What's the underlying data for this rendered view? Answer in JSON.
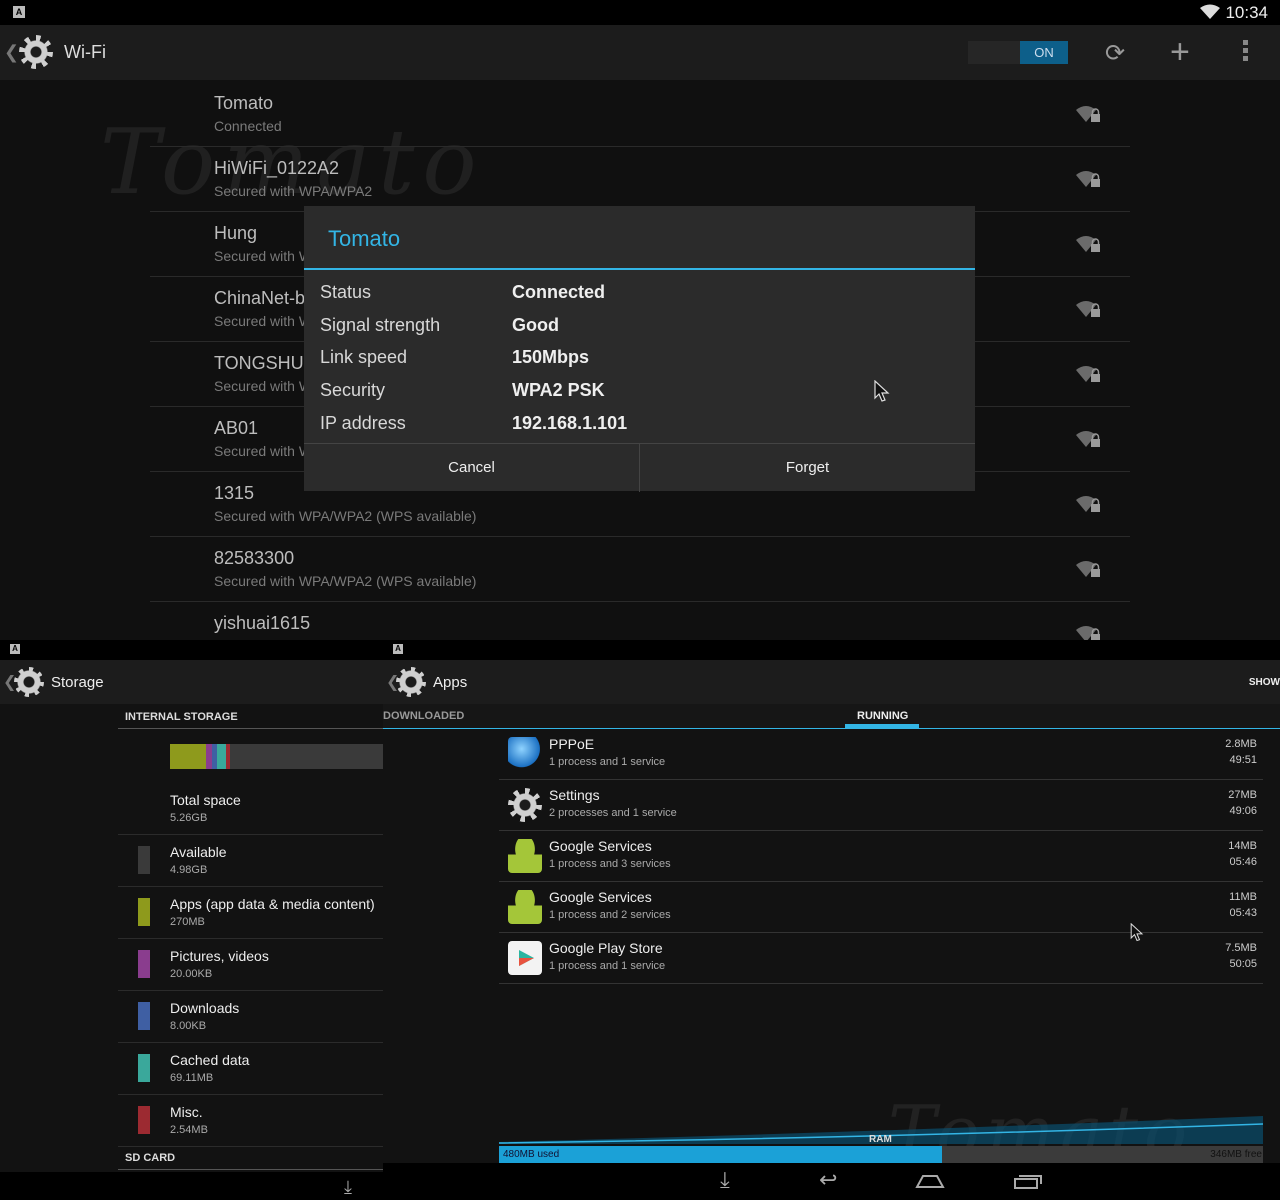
{
  "status_bar": {
    "time": "10:34",
    "notification_glyph": "A"
  },
  "wifi": {
    "back_glyph": "❮",
    "title": "Wi-Fi",
    "toggle_label": "ON",
    "networks": [
      {
        "name": "Tomato",
        "status": "Connected"
      },
      {
        "name": "HiWiFi_0122A2",
        "status": "Secured with WPA/WPA2"
      },
      {
        "name": "Hung",
        "status": "Secured with W"
      },
      {
        "name": "ChinaNet-b",
        "status": "Secured with W"
      },
      {
        "name": "TONGSHUN",
        "status": "Secured with W"
      },
      {
        "name": "AB01",
        "status": "Secured with W"
      },
      {
        "name": "1315",
        "status": "Secured with WPA/WPA2 (WPS available)"
      },
      {
        "name": "82583300",
        "status": "Secured with WPA/WPA2 (WPS available)"
      },
      {
        "name": "yishuai1615",
        "status": ""
      }
    ],
    "watermark": "Tomato"
  },
  "dialog": {
    "title": "Tomato",
    "rows": [
      {
        "label": "Status",
        "value": "Connected"
      },
      {
        "label": "Signal strength",
        "value": "Good"
      },
      {
        "label": "Link speed",
        "value": "150Mbps"
      },
      {
        "label": "Security",
        "value": "WPA2 PSK"
      },
      {
        "label": "IP address",
        "value": "192.168.1.101"
      }
    ],
    "cancel_label": "Cancel",
    "forget_label": "Forget"
  },
  "storage": {
    "notification_glyph": "A",
    "back_glyph": "❮",
    "title": "Storage",
    "internal_header": "INTERNAL STORAGE",
    "sd_header": "SD CARD",
    "total_label": "Total space",
    "total_value": "5.26GB",
    "items": [
      {
        "label": "Available",
        "value": "4.98GB",
        "color": "#3a3a3a"
      },
      {
        "label": "Apps (app data & media content)",
        "value": "270MB",
        "color": "#8e9a1c"
      },
      {
        "label": "Pictures, videos",
        "value": "20.00KB",
        "color": "#8a3d8e"
      },
      {
        "label": "Downloads",
        "value": "8.00KB",
        "color": "#3f5fa3"
      },
      {
        "label": "Cached data",
        "value": "69.11MB",
        "color": "#3aa89b"
      },
      {
        "label": "Misc.",
        "value": "2.54MB",
        "color": "#9c2a31"
      }
    ]
  },
  "apps": {
    "notification_glyph": "A",
    "back_glyph": "❮",
    "title": "Apps",
    "show_label": "SHOW",
    "tabs": {
      "downloaded": "DOWNLOADED",
      "running": "RUNNING"
    },
    "running": [
      {
        "name": "PPPoE",
        "detail": "1 process and 1 service",
        "size": "2.8MB",
        "time": "49:51",
        "icon": "pppoe-globe-icon"
      },
      {
        "name": "Settings",
        "detail": "2 processes and 1 service",
        "size": "27MB",
        "time": "49:06",
        "icon": "settings-gear-icon"
      },
      {
        "name": "Google Services",
        "detail": "1 process and 3 services",
        "size": "14MB",
        "time": "05:46",
        "icon": "android-icon"
      },
      {
        "name": "Google Services",
        "detail": "1 process and 2 services",
        "size": "11MB",
        "time": "05:43",
        "icon": "android-icon"
      },
      {
        "name": "Google Play Store",
        "detail": "1 process and 1 service",
        "size": "7.5MB",
        "time": "50:05",
        "icon": "play-store-icon"
      }
    ],
    "ram": {
      "label": "RAM",
      "used": "480MB used",
      "free": "346MB free",
      "used_fraction": 0.58
    },
    "watermark": "Tomato"
  },
  "colors": {
    "accent": "#33b5e5",
    "toggle_on": "#0d5f8a"
  }
}
